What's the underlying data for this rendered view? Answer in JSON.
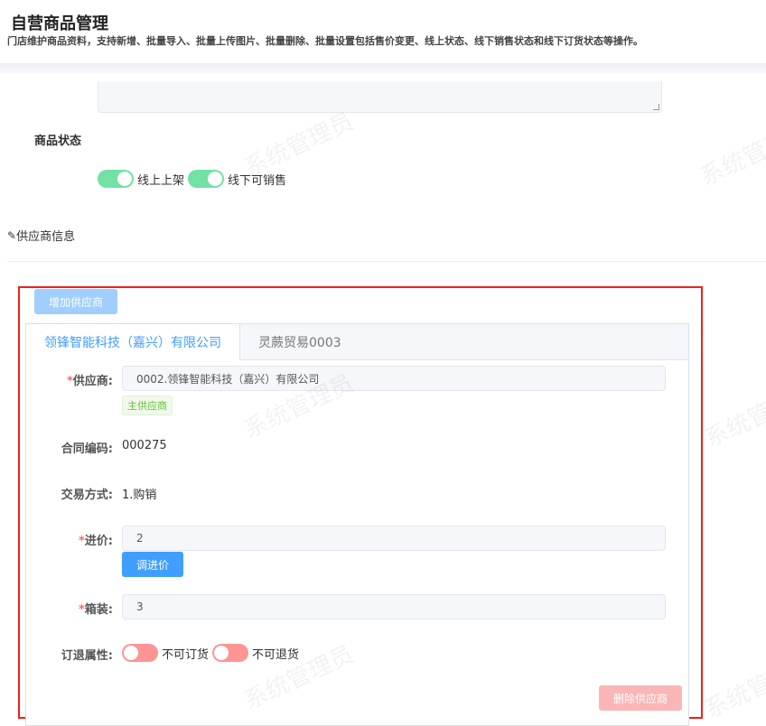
{
  "header": {
    "title": "自营商品管理",
    "description": "门店维护商品资料，支持新增、批量导入、批量上传图片、批量删除、批量设置包括售价变更、线上状态、线下销售状态和线下订货状态等操作。"
  },
  "status": {
    "label": "商品状态",
    "online": {
      "label": "线上上架",
      "on": true
    },
    "offline": {
      "label": "线下可销售",
      "on": true
    }
  },
  "supplier_section": {
    "title": "供应商信息",
    "add_button": "增加供应商",
    "tabs": [
      {
        "label": "领锋智能科技（嘉兴）有限公司",
        "active": true
      },
      {
        "label": "灵蕨贸易0003",
        "active": false
      }
    ],
    "form": {
      "supplier": {
        "label": "供应商:",
        "value": "0002.领锋智能科技（嘉兴）有限公司",
        "tag": "主供应商"
      },
      "contract": {
        "label": "合同编码:",
        "value": "000275"
      },
      "trade": {
        "label": "交易方式:",
        "value": "1.购销"
      },
      "price": {
        "label": "进价:",
        "value": "2",
        "button": "调进价"
      },
      "pack": {
        "label": "箱装:",
        "value": "3"
      },
      "order_return": {
        "label": "订退属性:",
        "order": {
          "label": "不可订货",
          "on": false
        },
        "return": {
          "label": "不可退货",
          "on": false
        }
      }
    },
    "delete_button": "删除供应商"
  },
  "watermark": "系统管理员",
  "colors": {
    "primary": "#409eff",
    "switch_on": "#71e2a3",
    "switch_off": "#ff9494",
    "highlight": "#f0201a"
  }
}
